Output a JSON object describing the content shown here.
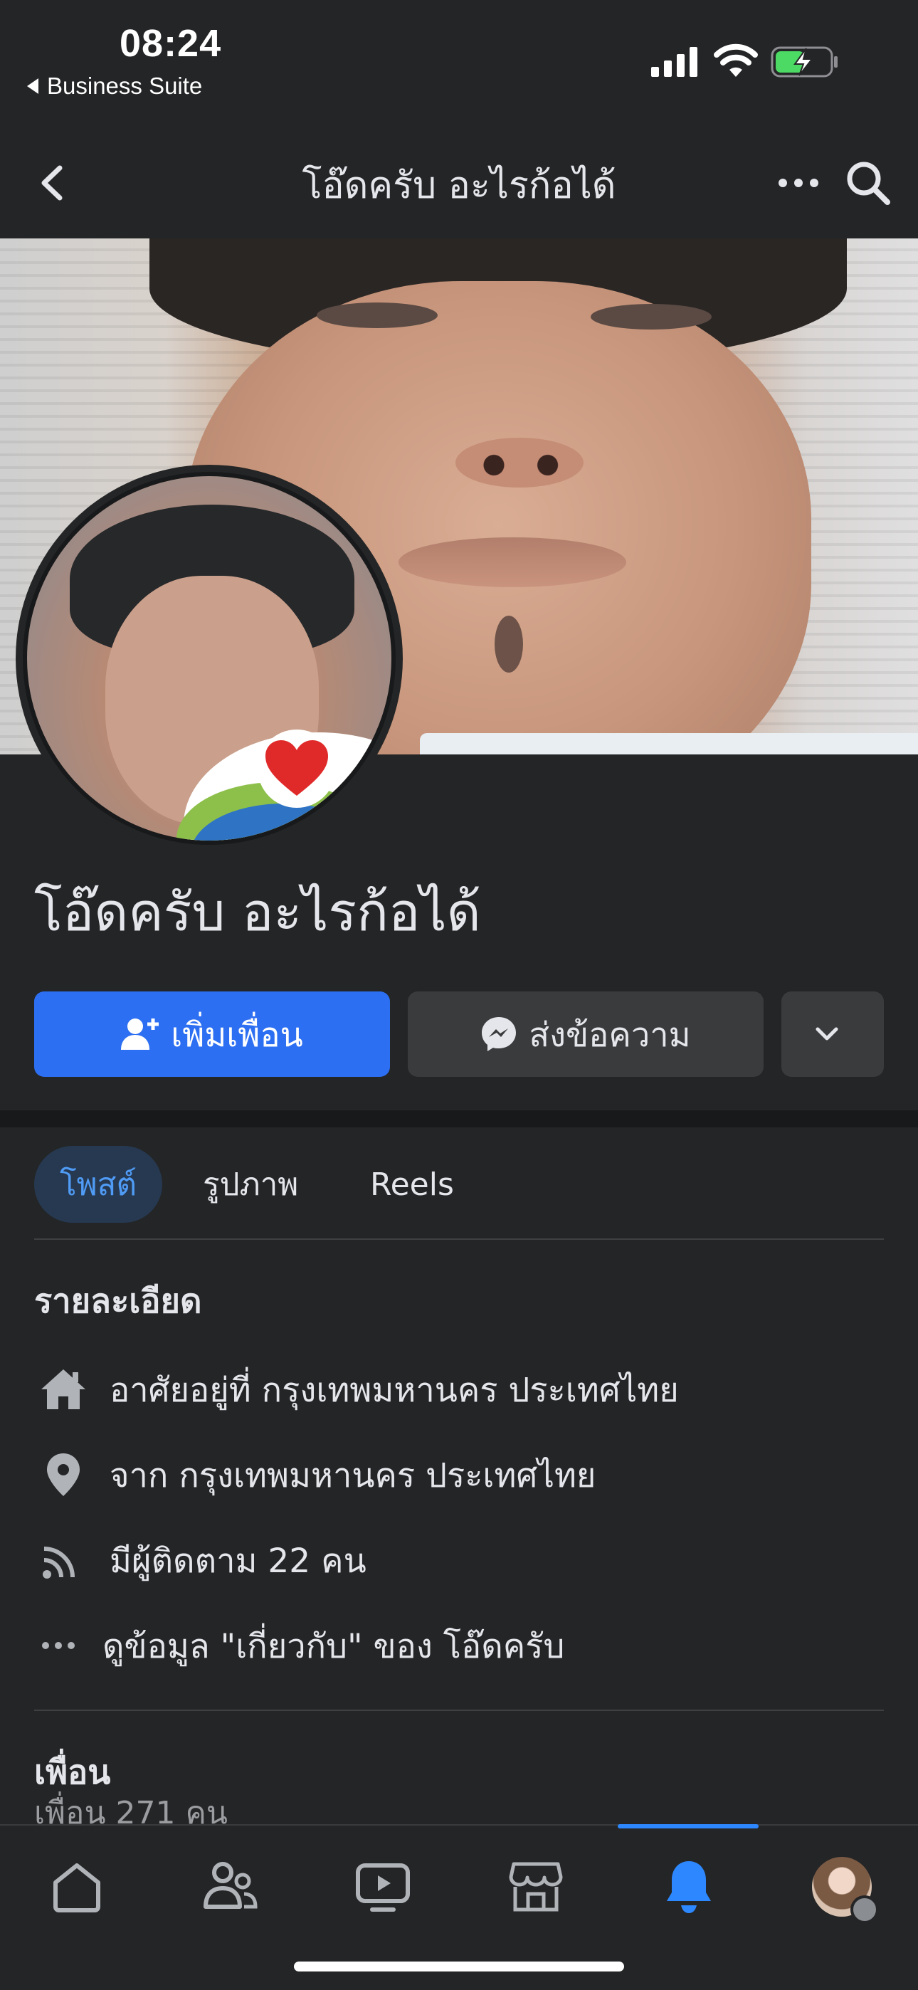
{
  "status_bar": {
    "time": "08:24",
    "back_app": "Business Suite"
  },
  "header": {
    "title": "โอ๊ดครับ อะไรก้อได้"
  },
  "profile": {
    "name": "โอ๊ดครับ อะไรก้อได้",
    "add_friend_label": "เพิ่มเพื่อน",
    "message_label": "ส่งข้อความ"
  },
  "tabs": [
    {
      "label": "โพสต์",
      "active": true
    },
    {
      "label": "รูปภาพ",
      "active": false
    },
    {
      "label": "Reels",
      "active": false
    }
  ],
  "details": {
    "title": "รายละเอียด",
    "items": [
      {
        "icon": "home-icon",
        "text": "อาศัยอยู่ที่ กรุงเทพมหานคร ประเทศไทย"
      },
      {
        "icon": "location-pin-icon",
        "text": "จาก กรุงเทพมหานคร ประเทศไทย"
      },
      {
        "icon": "rss-feed-icon",
        "text": "มีผู้ติดตาม 22 คน"
      },
      {
        "icon": "more-dots-icon",
        "text": "ดูข้อมูล \"เกี่ยวกับ\" ของ โอ๊ดครับ"
      }
    ]
  },
  "friends": {
    "title": "เพื่อน",
    "count": "เพื่อน 271 คน"
  },
  "bottom_nav": {
    "items": [
      "home-icon",
      "friends-icon",
      "video-icon",
      "marketplace-icon",
      "notifications-icon",
      "profile-menu-avatar"
    ],
    "active": "notifications-icon"
  },
  "colors": {
    "background": "#242526",
    "accent": "#2d6ff2",
    "active_tab_bg": "#263951",
    "active_tab_text": "#4f9bf5",
    "battery_charging": "#4cd964"
  }
}
